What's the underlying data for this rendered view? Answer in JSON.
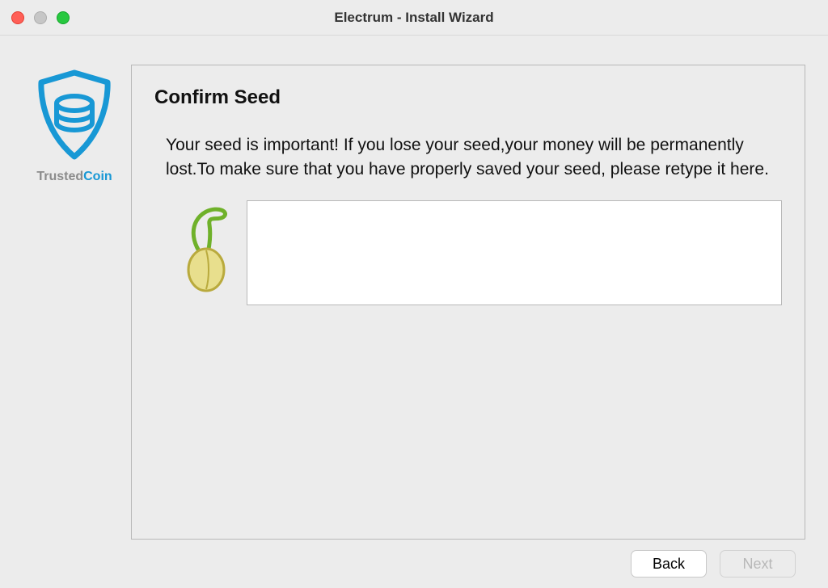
{
  "window": {
    "title": "Electrum  -  Install Wizard"
  },
  "sidebar": {
    "brand_a": "Trusted",
    "brand_b": "Coin"
  },
  "main": {
    "heading": "Confirm Seed",
    "instructions": "Your seed is important! If you lose your seed,your money will be permanently lost.To make sure that you have properly saved your seed, please retype it here.",
    "seed_value": "",
    "seed_placeholder": ""
  },
  "footer": {
    "back_label": "Back",
    "next_label": "Next",
    "next_enabled": false
  },
  "colors": {
    "accent": "#1898d5"
  }
}
